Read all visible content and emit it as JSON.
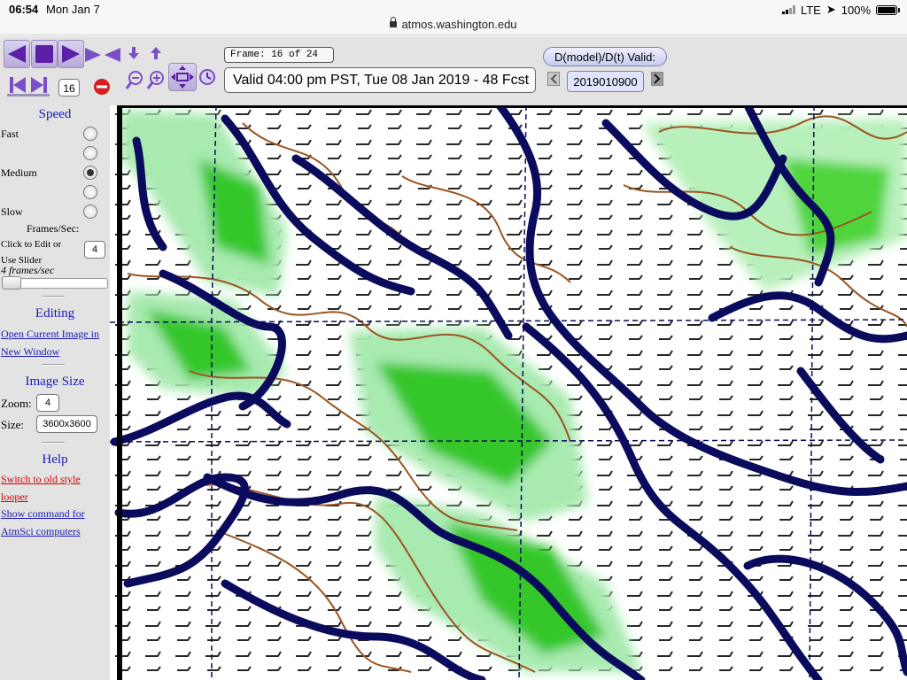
{
  "status": {
    "time": "06:54",
    "date": "Mon Jan 7",
    "carrier": "LTE",
    "battery": "100%"
  },
  "url": "atmos.washington.edu",
  "toolbar": {
    "frame_label": "Frame: 16 of 24",
    "frame_number": "16",
    "valid_text": "Valid 04:00 pm PST, Tue 08 Jan 2019 - 48 Fcst",
    "dmodel_label": "D(model)/D(t) Valid:",
    "model_date": "2019010900"
  },
  "sidebar": {
    "speed": {
      "title": "Speed",
      "fast": "Fast",
      "medium": "Medium",
      "slow": "Slow",
      "selected": "medium"
    },
    "frames_per_sec_label": "Frames/Sec:",
    "click_to_edit": "Click to Edit or Use Slider",
    "fps_value": "4",
    "fps_display": "4 frames/sec",
    "editing": {
      "title": "Editing",
      "open_link": "Open Current Image in New Window"
    },
    "image_size": {
      "title": "Image Size",
      "zoom_label": "Zoom:",
      "zoom_value": "4",
      "size_label": "Size:",
      "size_value": "3600x3600"
    },
    "help": {
      "title": "Help",
      "switch_link": "Switch to old style looper",
      "show_command_link": "Show command for AtmSci computers"
    }
  },
  "colors": {
    "accent_purple": "#5b1fa8",
    "toolbar_bg": "#e3e3e3",
    "link_blue": "#1b1bb5",
    "link_red": "#d40000",
    "coast_navy": "#0b0b5e",
    "terrain_brown": "#9a5522",
    "precip_green": "#3bcc2b"
  }
}
